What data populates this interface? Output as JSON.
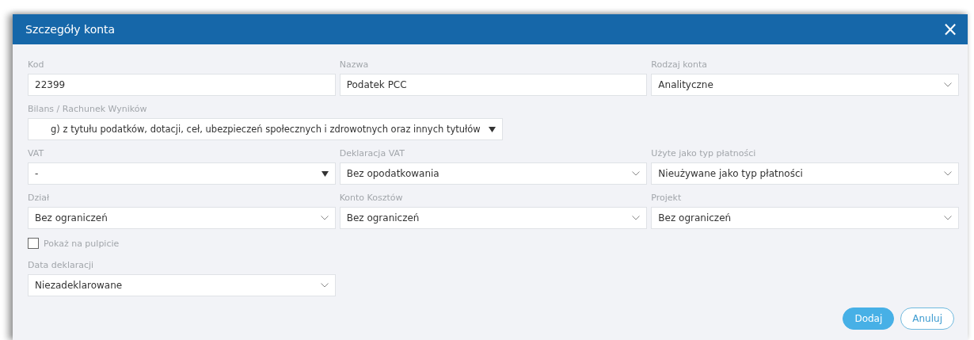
{
  "dialog": {
    "title": "Szczegóły konta",
    "close_label": "×"
  },
  "rows": [
    {
      "fields": [
        {
          "kind": "text",
          "label": "Kod",
          "value": "22399"
        },
        {
          "kind": "text",
          "label": "Nazwa",
          "value": "Podatek PCC"
        },
        {
          "kind": "select",
          "label": "Rodzaj konta",
          "value": "Analityczne"
        }
      ]
    },
    {
      "fields": [
        {
          "kind": "tree-select",
          "label": "Bilans / Rachunek Wyników",
          "value": "g) z tytułu podatków, dotacji, ceł, ubezpieczeń społecznych i zdrowotnych oraz innych tytułów"
        }
      ]
    },
    {
      "fields": [
        {
          "kind": "dropdown",
          "label": "VAT",
          "value": "-"
        },
        {
          "kind": "select",
          "label": "Deklaracja VAT",
          "value": "Bez opodatkowania"
        },
        {
          "kind": "select",
          "label": "Użyte jako typ płatności",
          "value": "Nieużywane jako typ płatności"
        }
      ]
    },
    {
      "fields": [
        {
          "kind": "select",
          "label": "Dział",
          "value": "Bez ograniczeń"
        },
        {
          "kind": "select",
          "label": "Konto Kosztów",
          "value": "Bez ograniczeń"
        },
        {
          "kind": "select",
          "label": "Projekt",
          "value": "Bez ograniczeń"
        }
      ]
    },
    {
      "fields": [
        {
          "kind": "checkbox",
          "label": "Pokaż na pulpicie",
          "checked": false
        }
      ]
    },
    {
      "fields": [
        {
          "kind": "select",
          "label": "Data deklaracji",
          "value": "Niezadeklarowane"
        }
      ]
    }
  ],
  "buttons": [
    {
      "label": "Dodaj",
      "kind": "primary"
    },
    {
      "label": "Anuluj",
      "kind": "secondary"
    }
  ]
}
